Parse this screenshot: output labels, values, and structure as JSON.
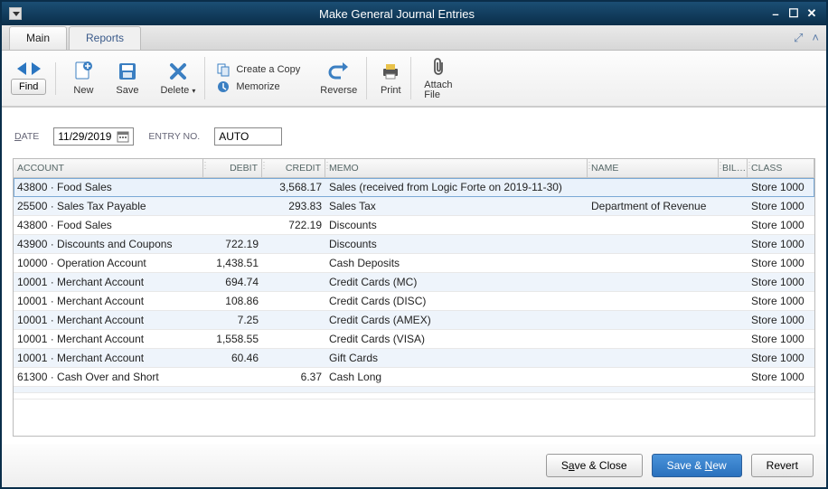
{
  "window": {
    "title": "Make General Journal Entries"
  },
  "tabs": {
    "main": "Main",
    "reports": "Reports"
  },
  "ribbon": {
    "find": "Find",
    "new": "New",
    "save": "Save",
    "delete": "Delete",
    "create_copy": "Create a Copy",
    "memorize": "Memorize",
    "reverse": "Reverse",
    "print": "Print",
    "attach_file_l1": "Attach",
    "attach_file_l2": "File"
  },
  "fields": {
    "date_label": "DATE",
    "date_value": "11/29/2019",
    "entry_no_label": "ENTRY NO.",
    "entry_no_value": "AUTO"
  },
  "columns": {
    "account": "ACCOUNT",
    "debit": "DEBIT",
    "credit": "CREDIT",
    "memo": "MEMO",
    "name": "NAME",
    "bill": "BIL…",
    "class": "CLASS"
  },
  "rows": [
    {
      "account": "43800 · Food Sales",
      "debit": "",
      "credit": "3,568.17",
      "memo": "Sales (received from Logic Forte on 2019-11-30)",
      "name": "",
      "class": "Store 1000"
    },
    {
      "account": "25500 · Sales Tax Payable",
      "debit": "",
      "credit": "293.83",
      "memo": "Sales Tax",
      "name": "Department of Revenue",
      "class": "Store 1000"
    },
    {
      "account": "43800 · Food Sales",
      "debit": "",
      "credit": "722.19",
      "memo": "Discounts",
      "name": "",
      "class": "Store 1000"
    },
    {
      "account": "43900 · Discounts and Coupons",
      "debit": "722.19",
      "credit": "",
      "memo": "Discounts",
      "name": "",
      "class": "Store 1000"
    },
    {
      "account": "10000 · Operation Account",
      "debit": "1,438.51",
      "credit": "",
      "memo": "Cash Deposits",
      "name": "",
      "class": "Store 1000"
    },
    {
      "account": "10001 · Merchant Account",
      "debit": "694.74",
      "credit": "",
      "memo": "Credit Cards (MC)",
      "name": "",
      "class": "Store 1000"
    },
    {
      "account": "10001 · Merchant Account",
      "debit": "108.86",
      "credit": "",
      "memo": "Credit Cards (DISC)",
      "name": "",
      "class": "Store 1000"
    },
    {
      "account": "10001 · Merchant Account",
      "debit": "7.25",
      "credit": "",
      "memo": "Credit Cards (AMEX)",
      "name": "",
      "class": "Store 1000"
    },
    {
      "account": "10001 · Merchant Account",
      "debit": "1,558.55",
      "credit": "",
      "memo": "Credit Cards (VISA)",
      "name": "",
      "class": "Store 1000"
    },
    {
      "account": "10001 · Merchant Account",
      "debit": "60.46",
      "credit": "",
      "memo": "Gift Cards",
      "name": "",
      "class": "Store 1000"
    },
    {
      "account": "61300 · Cash Over and Short",
      "debit": "",
      "credit": "6.37",
      "memo": "Cash Long",
      "name": "",
      "class": "Store 1000"
    },
    {
      "account": "",
      "debit": "",
      "credit": "",
      "memo": "",
      "name": "",
      "class": ""
    },
    {
      "account": "",
      "debit": "",
      "credit": "",
      "memo": "",
      "name": "",
      "class": ""
    }
  ],
  "footer": {
    "save_close": "Save & Close",
    "save_new": "Save & New",
    "revert": "Revert"
  },
  "colors": {
    "accent": "#2a71bd"
  }
}
